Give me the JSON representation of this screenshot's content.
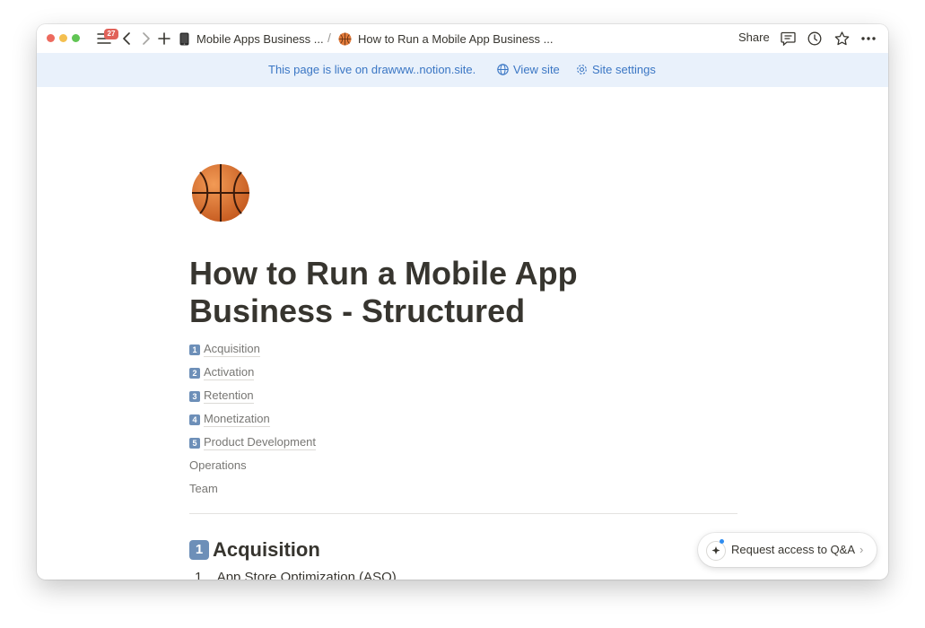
{
  "titlebar": {
    "notification_count": "27",
    "breadcrumbs": [
      {
        "label": "Mobile Apps Business ...",
        "icon": "phone-icon"
      },
      {
        "label": "How to Run a Mobile App Business ...",
        "icon": "basketball-icon"
      }
    ],
    "separator": "/",
    "share_label": "Share"
  },
  "banner": {
    "live_text": "This page is live on drawww..notion.site.",
    "view_site_label": "View site",
    "site_settings_label": "Site settings"
  },
  "page": {
    "title": "How to Run a Mobile App Business - Structured",
    "toc": [
      {
        "number": "1",
        "label": "Acquisition"
      },
      {
        "number": "2",
        "label": "Activation"
      },
      {
        "number": "3",
        "label": "Retention"
      },
      {
        "number": "4",
        "label": "Monetization"
      },
      {
        "number": "5",
        "label": "Product Development"
      },
      {
        "number": "",
        "label": "Operations"
      },
      {
        "number": "",
        "label": "Team"
      }
    ],
    "section_heading": {
      "number": "1",
      "label": "Acquisition"
    },
    "list_item_marker": "1.",
    "list_item": "App Store Optimization (ASO)"
  },
  "qa_button": {
    "label": "Request access to Q&A",
    "chevron": "›"
  },
  "colors": {
    "banner_bg": "#e9f1fb",
    "banner_text": "#3a76c4",
    "keycap": "#6d8fb8",
    "text": "#37352f",
    "muted": "#787774"
  }
}
